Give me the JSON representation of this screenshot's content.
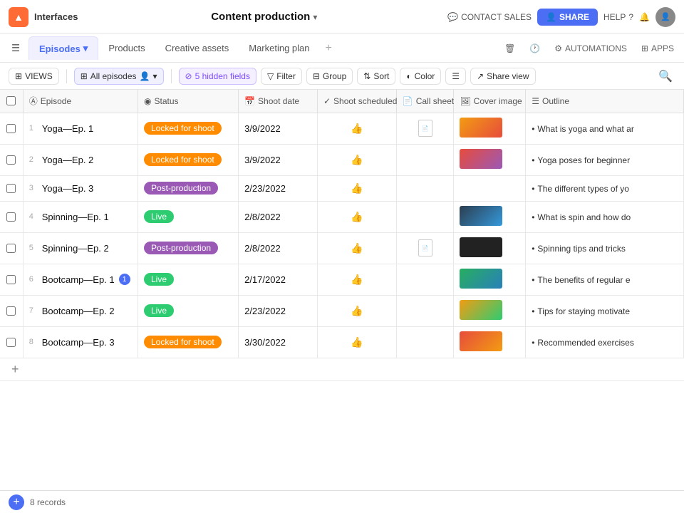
{
  "app": {
    "logo": "▲",
    "workspace": "Interfaces",
    "title": "Content production",
    "title_chevron": "▾"
  },
  "topnav": {
    "contact_label": "CONTACT SALES",
    "share_label": "SHARE",
    "help_label": "HELP",
    "automations_label": "AUTOMATIONS",
    "apps_label": "APPS"
  },
  "tabs": [
    {
      "label": "Episodes",
      "active": true,
      "has_dropdown": true
    },
    {
      "label": "Products",
      "active": false
    },
    {
      "label": "Creative assets",
      "active": false
    },
    {
      "label": "Marketing plan",
      "active": false
    }
  ],
  "toolbar": {
    "views_label": "VIEWS",
    "all_episodes_label": "All episodes",
    "hidden_fields_label": "5 hidden fields",
    "filter_label": "Filter",
    "group_label": "Group",
    "sort_label": "Sort",
    "color_label": "Color",
    "share_view_label": "Share view"
  },
  "columns": [
    {
      "icon": "text-icon",
      "label": "Episode"
    },
    {
      "icon": "status-icon",
      "label": "Status"
    },
    {
      "icon": "date-icon",
      "label": "Shoot date"
    },
    {
      "icon": "check-icon",
      "label": "Shoot scheduled"
    },
    {
      "icon": "doc-icon",
      "label": "Call sheet"
    },
    {
      "icon": "image-icon",
      "label": "Cover image"
    },
    {
      "icon": "list-icon",
      "label": "Outline"
    }
  ],
  "rows": [
    {
      "num": 1,
      "episode": "Yoga—Ep. 1",
      "status": "Locked for shoot",
      "status_type": "locked",
      "shoot_date": "3/9/2022",
      "shoot_scheduled": true,
      "call_sheet": true,
      "cover_image": true,
      "cover_class": "cover-img-yoga",
      "outline": "What is yoga and what ar"
    },
    {
      "num": 2,
      "episode": "Yoga—Ep. 2",
      "status": "Locked for shoot",
      "status_type": "locked",
      "shoot_date": "3/9/2022",
      "shoot_scheduled": true,
      "call_sheet": false,
      "cover_image": true,
      "cover_class": "cover-img-yoga2",
      "outline": "Yoga poses for beginner"
    },
    {
      "num": 3,
      "episode": "Yoga—Ep. 3",
      "status": "Post-production",
      "status_type": "post",
      "shoot_date": "2/23/2022",
      "shoot_scheduled": true,
      "call_sheet": false,
      "cover_image": false,
      "cover_class": "",
      "outline": "The different types of yo"
    },
    {
      "num": 4,
      "episode": "Spinning—Ep. 1",
      "status": "Live",
      "status_type": "live",
      "shoot_date": "2/8/2022",
      "shoot_scheduled": true,
      "call_sheet": false,
      "cover_image": true,
      "cover_class": "cover-img-spin",
      "outline": "What is spin and how do"
    },
    {
      "num": 5,
      "episode": "Spinning—Ep. 2",
      "status": "Post-production",
      "status_type": "post",
      "shoot_date": "2/8/2022",
      "shoot_scheduled": true,
      "call_sheet": true,
      "cover_image": true,
      "cover_class": "cover-img-spin2",
      "outline": "Spinning tips and tricks"
    },
    {
      "num": 6,
      "episode": "Bootcamp—Ep. 1",
      "status": "Live",
      "status_type": "live",
      "shoot_date": "2/17/2022",
      "shoot_scheduled": true,
      "call_sheet": false,
      "cover_image": true,
      "cover_class": "cover-img-boot1",
      "outline": "The benefits of regular e",
      "badge": "1"
    },
    {
      "num": 7,
      "episode": "Bootcamp—Ep. 2",
      "status": "Live",
      "status_type": "live",
      "shoot_date": "2/23/2022",
      "shoot_scheduled": true,
      "call_sheet": false,
      "cover_image": true,
      "cover_class": "cover-img-boot2",
      "outline": "Tips for staying motivate"
    },
    {
      "num": 8,
      "episode": "Bootcamp—Ep. 3",
      "status": "Locked for shoot",
      "status_type": "locked",
      "shoot_date": "3/30/2022",
      "shoot_scheduled": true,
      "call_sheet": false,
      "cover_image": true,
      "cover_class": "cover-img-boot3",
      "outline": "Recommended exercises"
    }
  ],
  "footer": {
    "record_count": "8 records"
  }
}
